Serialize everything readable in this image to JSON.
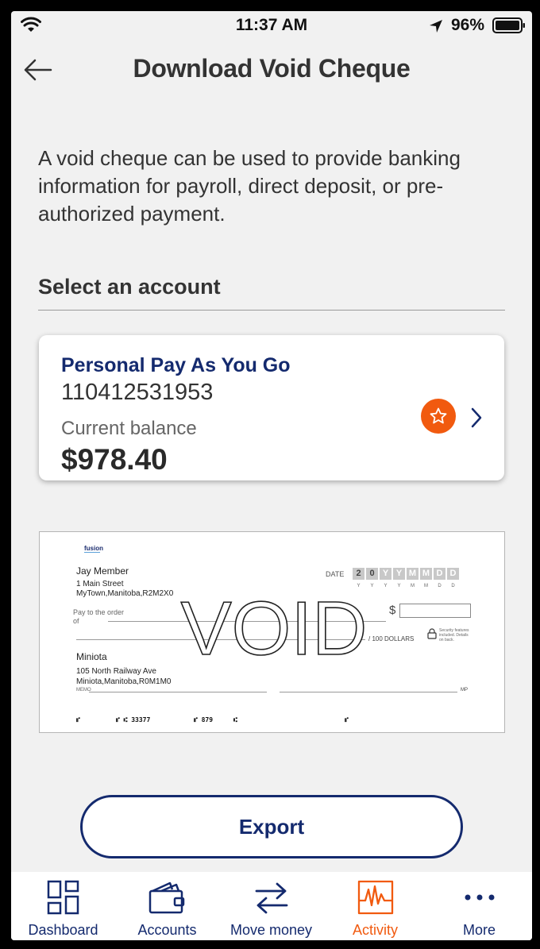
{
  "status_bar": {
    "time": "11:37 AM",
    "battery": "96%"
  },
  "header": {
    "title": "Download Void Cheque"
  },
  "description": "A void cheque can be used to provide banking information for payroll, direct deposit, or pre-authorized payment.",
  "section_label": "Select an account",
  "account": {
    "name": "Personal Pay As You Go",
    "number": "110412531953",
    "balance_label": "Current balance",
    "balance": "$978.40"
  },
  "cheque": {
    "logo": "fusion",
    "account_holder": "Jay Member",
    "address_line1": "1 Main Street",
    "address_line2": "MyTown,Manitoba,R2M2X0",
    "date_label": "DATE",
    "date_boxes": [
      "2",
      "0",
      "Y",
      "Y",
      "M",
      "M",
      "D",
      "D"
    ],
    "date_format": [
      "Y",
      "Y",
      "Y",
      "Y",
      "M",
      "M",
      "D",
      "D"
    ],
    "pay_to_label": "Pay to the order of",
    "dollar_sign": "$",
    "dollars_label": "/ 100 DOLLARS",
    "security_note": "Security features included. Details on back.",
    "void_text": "VOID",
    "payee": "Miniota",
    "payee_address1": "105 North Railway Ave",
    "payee_address2": "Miniota,Manitoba,R0M1M0",
    "memo_label": "MEMO",
    "mp_label": "MP",
    "micr": [
      "⑈",
      "⑈  ⑆ 33377",
      "⑈ 879",
      "⑆",
      "⑈"
    ]
  },
  "export_label": "Export",
  "tabs": [
    {
      "label": "Dashboard",
      "icon": "dashboard-icon"
    },
    {
      "label": "Accounts",
      "icon": "wallet-icon"
    },
    {
      "label": "Move money",
      "icon": "transfer-arrows-icon"
    },
    {
      "label": "Activity",
      "icon": "activity-chart-icon",
      "active": true
    },
    {
      "label": "More",
      "icon": "more-dots-icon"
    }
  ],
  "colors": {
    "navy": "#142a6e",
    "accent_orange": "#f15a0f"
  }
}
